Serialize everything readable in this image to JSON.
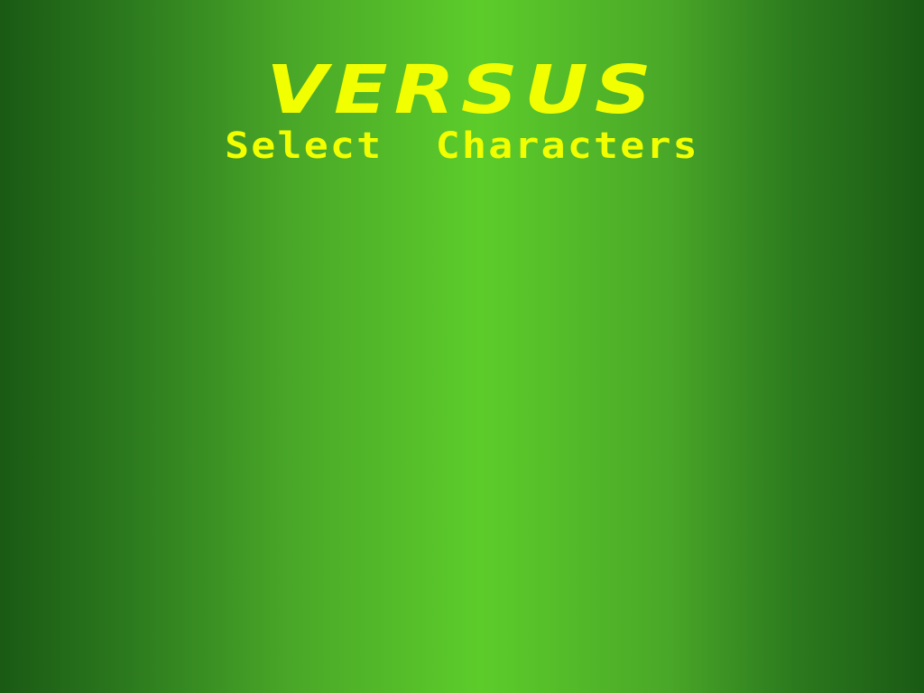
{
  "screen": {
    "title": "VERSUS",
    "subtitle": "Select  Characters"
  },
  "colors": {
    "title_text": "#f2ff00",
    "background_center": "#5ccc2a",
    "background_edge": "#1a5a14"
  }
}
